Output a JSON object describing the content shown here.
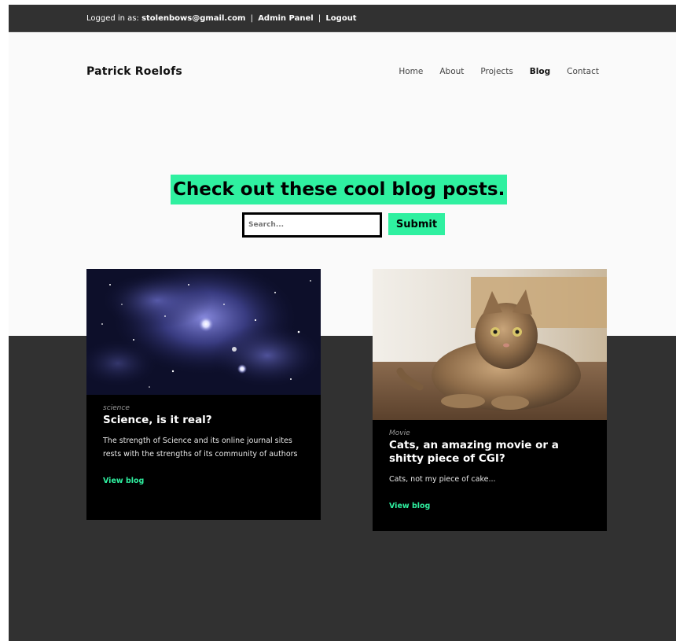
{
  "topbar": {
    "logged_in_prefix": "Logged in as:",
    "email": "stolenbows@gmail.com",
    "separator_1": "|",
    "admin_panel": "Admin Panel",
    "separator_2": "|",
    "logout": "Logout"
  },
  "header": {
    "brand": "Patrick Roelofs",
    "nav": [
      {
        "label": "Home"
      },
      {
        "label": "About"
      },
      {
        "label": "Projects"
      },
      {
        "label": "Blog",
        "active": true
      },
      {
        "label": "Contact"
      }
    ]
  },
  "hero": {
    "title": "Check out these cool blog posts."
  },
  "search": {
    "placeholder": "Search...",
    "submit_label": "Submit"
  },
  "posts": [
    {
      "category": "science",
      "title": "Science, is it real?",
      "description": "The strength of Science and its online journal sites rests with the strengths of its community of authors",
      "link": "View blog"
    },
    {
      "category": "Movie",
      "title": "Cats, an amazing movie or a shitty piece of CGI?",
      "description": "Cats, not my piece of cake...",
      "link": "View blog"
    }
  ],
  "colors": {
    "accent": "#2ff0a0",
    "dark_band": "#313131",
    "card_bg": "#000000"
  }
}
